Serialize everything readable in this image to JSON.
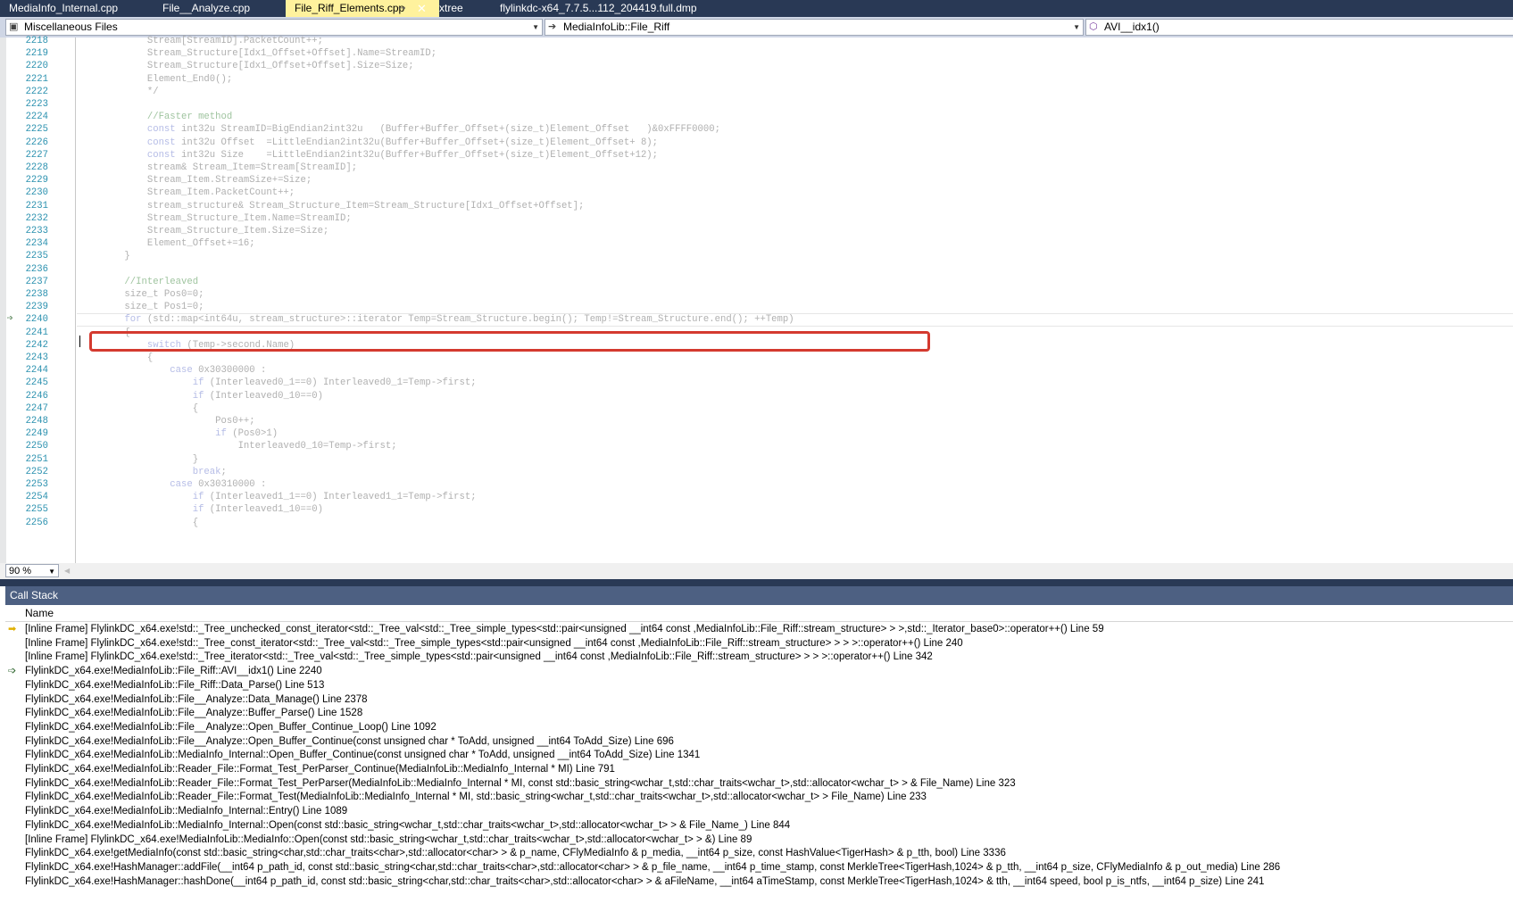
{
  "tabs": [
    {
      "label": "MediaInfo_Internal.cpp",
      "active": false
    },
    {
      "label": "File__Analyze.cpp",
      "active": false
    },
    {
      "label": "File_Riff_Elements.cpp",
      "active": true
    },
    {
      "label": "xtree",
      "active": false
    },
    {
      "label": "flylinkdc-x64_7.7.5...112_204419.full.dmp",
      "active": false
    }
  ],
  "tab_icons": {
    "pin": "pin-icon",
    "close": "close-icon"
  },
  "navbar": {
    "project": "Miscellaneous Files",
    "scope": "MediaInfoLib::File_Riff",
    "member": "AVI__idx1()"
  },
  "editor": {
    "current_line": "2240",
    "lines": [
      {
        "n": "2218",
        "t": "        Stream[StreamID].PacketCount++;"
      },
      {
        "n": "2219",
        "t": "        Stream_Structure[Idx1_Offset+Offset].Name=StreamID;"
      },
      {
        "n": "2220",
        "t": "        Stream_Structure[Idx1_Offset+Offset].Size=Size;"
      },
      {
        "n": "2221",
        "t": "        Element_End0();"
      },
      {
        "n": "2222",
        "t": "        */"
      },
      {
        "n": "2223",
        "t": ""
      },
      {
        "n": "2224",
        "t": "        //Faster method"
      },
      {
        "n": "2225",
        "t": "        const int32u StreamID=BigEndian2int32u   (Buffer+Buffer_Offset+(size_t)Element_Offset   )&0xFFFF0000;"
      },
      {
        "n": "2226",
        "t": "        const int32u Offset  =LittleEndian2int32u(Buffer+Buffer_Offset+(size_t)Element_Offset+ 8);"
      },
      {
        "n": "2227",
        "t": "        const int32u Size    =LittleEndian2int32u(Buffer+Buffer_Offset+(size_t)Element_Offset+12);"
      },
      {
        "n": "2228",
        "t": "        stream& Stream_Item=Stream[StreamID];"
      },
      {
        "n": "2229",
        "t": "        Stream_Item.StreamSize+=Size;"
      },
      {
        "n": "2230",
        "t": "        Stream_Item.PacketCount++;"
      },
      {
        "n": "2231",
        "t": "        stream_structure& Stream_Structure_Item=Stream_Structure[Idx1_Offset+Offset];"
      },
      {
        "n": "2232",
        "t": "        Stream_Structure_Item.Name=StreamID;"
      },
      {
        "n": "2233",
        "t": "        Stream_Structure_Item.Size=Size;"
      },
      {
        "n": "2234",
        "t": "        Element_Offset+=16;"
      },
      {
        "n": "2235",
        "t": "    }"
      },
      {
        "n": "2236",
        "t": ""
      },
      {
        "n": "2237",
        "t": "    //Interleaved"
      },
      {
        "n": "2238",
        "t": "    size_t Pos0=0;"
      },
      {
        "n": "2239",
        "t": "    size_t Pos1=0;"
      },
      {
        "n": "2240",
        "t": "    for (std::map<int64u, stream_structure>::iterator Temp=Stream_Structure.begin(); Temp!=Stream_Structure.end(); ++Temp)"
      },
      {
        "n": "2241",
        "t": "    {"
      },
      {
        "n": "2242",
        "t": "        switch (Temp->second.Name)"
      },
      {
        "n": "2243",
        "t": "        {"
      },
      {
        "n": "2244",
        "t": "            case 0x30300000 :"
      },
      {
        "n": "2245",
        "t": "                if (Interleaved0_1==0) Interleaved0_1=Temp->first;"
      },
      {
        "n": "2246",
        "t": "                if (Interleaved0_10==0)"
      },
      {
        "n": "2247",
        "t": "                {"
      },
      {
        "n": "2248",
        "t": "                    Pos0++;"
      },
      {
        "n": "2249",
        "t": "                    if (Pos0>1)"
      },
      {
        "n": "2250",
        "t": "                        Interleaved0_10=Temp->first;"
      },
      {
        "n": "2251",
        "t": "                }"
      },
      {
        "n": "2252",
        "t": "                break;"
      },
      {
        "n": "2253",
        "t": "            case 0x30310000 :"
      },
      {
        "n": "2254",
        "t": "                if (Interleaved1_1==0) Interleaved1_1=Temp->first;"
      },
      {
        "n": "2255",
        "t": "                if (Interleaved1_10==0)"
      },
      {
        "n": "2256",
        "t": "                {"
      }
    ]
  },
  "zoom": {
    "value": "90 %"
  },
  "callstack": {
    "title": "Call Stack",
    "column_name": "Name",
    "rows": [
      {
        "marker": "current",
        "text": "[Inline Frame] FlylinkDC_x64.exe!std::_Tree_unchecked_const_iterator<std::_Tree_val<std::_Tree_simple_types<std::pair<unsigned __int64 const ,MediaInfoLib::File_Riff::stream_structure> > >,std::_Iterator_base0>::operator++() Line 59"
      },
      {
        "marker": "",
        "text": "[Inline Frame] FlylinkDC_x64.exe!std::_Tree_const_iterator<std::_Tree_val<std::_Tree_simple_types<std::pair<unsigned __int64 const ,MediaInfoLib::File_Riff::stream_structure> > > >::operator++() Line 240"
      },
      {
        "marker": "",
        "text": "[Inline Frame] FlylinkDC_x64.exe!std::_Tree_iterator<std::_Tree_val<std::_Tree_simple_types<std::pair<unsigned __int64 const ,MediaInfoLib::File_Riff::stream_structure> > > >::operator++() Line 342"
      },
      {
        "marker": "frame",
        "text": "FlylinkDC_x64.exe!MediaInfoLib::File_Riff::AVI__idx1() Line 2240"
      },
      {
        "marker": "",
        "text": "FlylinkDC_x64.exe!MediaInfoLib::File_Riff::Data_Parse() Line 513"
      },
      {
        "marker": "",
        "text": "FlylinkDC_x64.exe!MediaInfoLib::File__Analyze::Data_Manage() Line 2378"
      },
      {
        "marker": "",
        "text": "FlylinkDC_x64.exe!MediaInfoLib::File__Analyze::Buffer_Parse() Line 1528"
      },
      {
        "marker": "",
        "text": "FlylinkDC_x64.exe!MediaInfoLib::File__Analyze::Open_Buffer_Continue_Loop() Line 1092"
      },
      {
        "marker": "",
        "text": "FlylinkDC_x64.exe!MediaInfoLib::File__Analyze::Open_Buffer_Continue(const unsigned char * ToAdd, unsigned __int64 ToAdd_Size) Line 696"
      },
      {
        "marker": "",
        "text": "FlylinkDC_x64.exe!MediaInfoLib::MediaInfo_Internal::Open_Buffer_Continue(const unsigned char * ToAdd, unsigned __int64 ToAdd_Size) Line 1341"
      },
      {
        "marker": "",
        "text": "FlylinkDC_x64.exe!MediaInfoLib::Reader_File::Format_Test_PerParser_Continue(MediaInfoLib::MediaInfo_Internal * MI) Line 791"
      },
      {
        "marker": "",
        "text": "FlylinkDC_x64.exe!MediaInfoLib::Reader_File::Format_Test_PerParser(MediaInfoLib::MediaInfo_Internal * MI, const std::basic_string<wchar_t,std::char_traits<wchar_t>,std::allocator<wchar_t> > & File_Name) Line 323"
      },
      {
        "marker": "",
        "text": "FlylinkDC_x64.exe!MediaInfoLib::Reader_File::Format_Test(MediaInfoLib::MediaInfo_Internal * MI, std::basic_string<wchar_t,std::char_traits<wchar_t>,std::allocator<wchar_t> > File_Name) Line 233"
      },
      {
        "marker": "",
        "text": "FlylinkDC_x64.exe!MediaInfoLib::MediaInfo_Internal::Entry() Line 1089"
      },
      {
        "marker": "",
        "text": "FlylinkDC_x64.exe!MediaInfoLib::MediaInfo_Internal::Open(const std::basic_string<wchar_t,std::char_traits<wchar_t>,std::allocator<wchar_t> > & File_Name_) Line 844"
      },
      {
        "marker": "",
        "text": "[Inline Frame] FlylinkDC_x64.exe!MediaInfoLib::MediaInfo::Open(const std::basic_string<wchar_t,std::char_traits<wchar_t>,std::allocator<wchar_t> > &) Line 89"
      },
      {
        "marker": "",
        "text": "FlylinkDC_x64.exe!getMediaInfo(const std::basic_string<char,std::char_traits<char>,std::allocator<char> > & p_name, CFlyMediaInfo & p_media, __int64 p_size, const HashValue<TigerHash> & p_tth, bool) Line 3336"
      },
      {
        "marker": "",
        "text": "FlylinkDC_x64.exe!HashManager::addFile(__int64 p_path_id, const std::basic_string<char,std::char_traits<char>,std::allocator<char> > & p_file_name, __int64 p_time_stamp, const MerkleTree<TigerHash,1024> & p_tth, __int64 p_size, CFlyMediaInfo & p_out_media) Line 286"
      },
      {
        "marker": "",
        "text": "FlylinkDC_x64.exe!HashManager::hashDone(__int64 p_path_id, const std::basic_string<char,std::char_traits<char>,std::allocator<char> > & aFileName, __int64 aTimeStamp, const MerkleTree<TigerHash,1024> & tth, __int64 speed, bool p_is_ntfs, __int64 p_size) Line 241"
      }
    ]
  }
}
